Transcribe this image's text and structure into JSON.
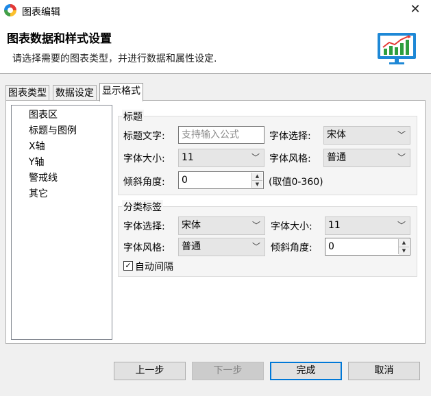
{
  "window": {
    "title": "图表编辑",
    "close_glyph": "✕"
  },
  "header": {
    "title": "图表数据和样式设置",
    "description": "请选择需要的图表类型，并进行数据和属性设定."
  },
  "tabs": [
    {
      "label": "图表类型"
    },
    {
      "label": "数据设定"
    },
    {
      "label": "显示格式",
      "active": true
    }
  ],
  "nav_list": [
    "图表区",
    "标题与图例",
    "X轴",
    "Y轴",
    "警戒线",
    "其它"
  ],
  "nav_selected": "X轴",
  "title_group": {
    "legend": "标题",
    "title_text_label": "标题文字:",
    "title_text_placeholder": "支持输入公式",
    "font_select_label": "字体选择:",
    "font_select_value": "宋体",
    "font_size_label": "字体大小:",
    "font_size_value": "11",
    "font_style_label": "字体风格:",
    "font_style_value": "普通",
    "tilt_label": "倾斜角度:",
    "tilt_value": "0",
    "tilt_hint": "(取值0-360)"
  },
  "category_group": {
    "legend": "分类标签",
    "font_select_label": "字体选择:",
    "font_select_value": "宋体",
    "font_size_label": "字体大小:",
    "font_size_value": "11",
    "font_style_label": "字体风格:",
    "font_style_value": "普通",
    "tilt_label": "倾斜角度:",
    "tilt_value": "0",
    "auto_interval_label": "自动间隔",
    "auto_interval_checked": true
  },
  "buttons": {
    "prev": "上一步",
    "next": "下一步",
    "finish": "完成",
    "cancel": "取消"
  },
  "icons": {
    "chevron": "﹀",
    "check": "✓",
    "spin_up": "▲",
    "spin_down": "▼",
    "app": "app-logo-icon",
    "monitor": "monitor-chart-icon"
  },
  "colors": {
    "accent": "#0078d7",
    "monitor": "#1e88d6",
    "chart_green": "#2e9e3e",
    "chart_red": "#e53935"
  }
}
